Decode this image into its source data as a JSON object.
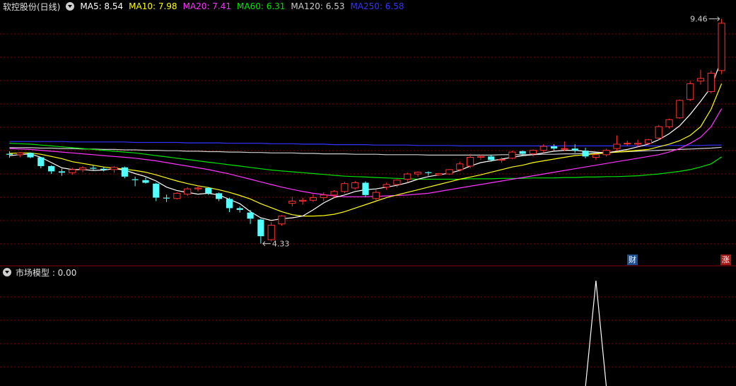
{
  "header": {
    "stock_title": "软控股份(日线)",
    "ma_labels": [
      {
        "text": "MA5: 8.54",
        "color": "#ffffff"
      },
      {
        "text": "MA10: 7.98",
        "color": "#ffff00"
      },
      {
        "text": "MA20: 7.41",
        "color": "#ff33ff"
      },
      {
        "text": "MA60: 6.31",
        "color": "#00e600"
      },
      {
        "text": "MA120: 6.53",
        "color": "#cccccc"
      },
      {
        "text": "MA250: 6.58",
        "color": "#3333ff"
      }
    ]
  },
  "sub_panel": {
    "label": "市场模型 : 0.00"
  },
  "badges": {
    "fin": "财",
    "limit_up": "涨"
  },
  "colors": {
    "up": "#ff3232",
    "down": "#54ffff",
    "grid": "#8b0000",
    "ma5": "#ffffff",
    "ma10": "#ffff00",
    "ma20": "#ff33ff",
    "ma60": "#00e600",
    "ma250": "#3333ff"
  },
  "chart_data": [
    {
      "type": "candlestick",
      "title": "软控股份(日线)",
      "ylim": [
        4.05,
        9.6
      ],
      "annotations": [
        {
          "text": "9.46",
          "value": 9.46,
          "candle_index": 68
        },
        {
          "text": "4.33",
          "value": 4.33,
          "candle_index": 24
        }
      ],
      "candles": [
        [
          6.38,
          6.44,
          6.29,
          6.36
        ],
        [
          6.36,
          6.42,
          6.3,
          6.4
        ],
        [
          6.4,
          6.41,
          6.28,
          6.3
        ],
        [
          6.3,
          6.31,
          6.05,
          6.1
        ],
        [
          6.1,
          6.12,
          5.92,
          5.98
        ],
        [
          5.98,
          6.04,
          5.88,
          5.95
        ],
        [
          5.95,
          6.06,
          5.9,
          6.02
        ],
        [
          6.02,
          6.1,
          5.96,
          6.06
        ],
        [
          6.06,
          6.12,
          6.0,
          6.04
        ],
        [
          6.04,
          6.08,
          5.98,
          6.02
        ],
        [
          6.02,
          6.1,
          5.95,
          6.07
        ],
        [
          6.07,
          6.09,
          5.82,
          5.86
        ],
        [
          5.8,
          5.86,
          5.64,
          5.78
        ],
        [
          5.78,
          5.84,
          5.7,
          5.72
        ],
        [
          5.7,
          5.72,
          5.3,
          5.38
        ],
        [
          5.38,
          5.45,
          5.28,
          5.36
        ],
        [
          5.36,
          5.5,
          5.34,
          5.48
        ],
        [
          5.46,
          5.62,
          5.42,
          5.58
        ],
        [
          5.58,
          5.66,
          5.52,
          5.6
        ],
        [
          5.6,
          5.62,
          5.44,
          5.48
        ],
        [
          5.48,
          5.5,
          5.3,
          5.35
        ],
        [
          5.35,
          5.38,
          5.05,
          5.14
        ],
        [
          5.14,
          5.18,
          5.04,
          5.1
        ],
        [
          5.04,
          5.1,
          4.78,
          4.9
        ],
        [
          4.88,
          4.9,
          4.33,
          4.5
        ],
        [
          4.42,
          4.82,
          4.38,
          4.75
        ],
        [
          4.78,
          4.98,
          4.74,
          4.96
        ],
        [
          5.25,
          5.4,
          5.18,
          5.3
        ],
        [
          5.3,
          5.38,
          5.22,
          5.32
        ],
        [
          5.32,
          5.46,
          5.28,
          5.38
        ],
        [
          5.38,
          5.5,
          5.3,
          5.44
        ],
        [
          5.44,
          5.55,
          5.38,
          5.52
        ],
        [
          5.52,
          5.74,
          5.48,
          5.7
        ],
        [
          5.6,
          5.76,
          5.56,
          5.72
        ],
        [
          5.72,
          5.75,
          5.4,
          5.44
        ],
        [
          5.36,
          5.56,
          5.32,
          5.5
        ],
        [
          5.62,
          5.72,
          5.56,
          5.68
        ],
        [
          5.68,
          5.8,
          5.62,
          5.78
        ],
        [
          5.8,
          5.95,
          5.74,
          5.92
        ],
        [
          5.92,
          5.98,
          5.86,
          5.96
        ],
        [
          5.96,
          5.98,
          5.88,
          5.94
        ],
        [
          5.9,
          5.94,
          5.88,
          5.93
        ],
        [
          5.92,
          6.03,
          5.9,
          6.02
        ],
        [
          6.02,
          6.2,
          5.98,
          6.15
        ],
        [
          6.1,
          6.38,
          6.05,
          6.3
        ],
        [
          6.3,
          6.36,
          6.24,
          6.32
        ],
        [
          6.32,
          6.36,
          6.2,
          6.24
        ],
        [
          6.24,
          6.3,
          6.18,
          6.25
        ],
        [
          6.28,
          6.45,
          6.26,
          6.42
        ],
        [
          6.44,
          6.46,
          6.34,
          6.38
        ],
        [
          6.38,
          6.48,
          6.32,
          6.46
        ],
        [
          6.46,
          6.6,
          6.4,
          6.55
        ],
        [
          6.55,
          6.6,
          6.44,
          6.5
        ],
        [
          6.5,
          6.66,
          6.44,
          6.5
        ],
        [
          6.5,
          6.6,
          6.4,
          6.45
        ],
        [
          6.45,
          6.52,
          6.28,
          6.32
        ],
        [
          6.3,
          6.38,
          6.24,
          6.36
        ],
        [
          6.36,
          6.5,
          6.32,
          6.46
        ],
        [
          6.5,
          6.8,
          6.44,
          6.6
        ],
        [
          6.62,
          6.68,
          6.56,
          6.62
        ],
        [
          6.6,
          6.7,
          6.52,
          6.62
        ],
        [
          6.62,
          6.72,
          6.58,
          6.7
        ],
        [
          6.74,
          7.04,
          6.7,
          7.0
        ],
        [
          7.0,
          7.18,
          6.96,
          7.16
        ],
        [
          7.2,
          7.62,
          7.18,
          7.6
        ],
        [
          7.62,
          8.04,
          7.58,
          7.98
        ],
        [
          8.04,
          8.3,
          7.96,
          8.1
        ],
        [
          7.8,
          8.28,
          7.76,
          8.22
        ],
        [
          8.28,
          9.46,
          8.2,
          9.36
        ]
      ],
      "ma5": [
        6.34,
        6.36,
        6.38,
        6.3,
        6.18,
        6.06,
        6.02,
        6.02,
        6.0,
        6.01,
        6.04,
        6.01,
        5.93,
        5.86,
        5.76,
        5.62,
        5.54,
        5.5,
        5.46,
        5.48,
        5.44,
        5.34,
        5.24,
        5.06,
        4.92,
        4.86,
        4.9,
        4.92,
        4.96,
        5.1,
        5.26,
        5.38,
        5.44,
        5.52,
        5.56,
        5.58,
        5.62,
        5.66,
        5.72,
        5.8,
        5.86,
        5.9,
        5.94,
        6.0,
        6.1,
        6.18,
        6.22,
        6.26,
        6.3,
        6.34,
        6.36,
        6.4,
        6.44,
        6.46,
        6.46,
        6.44,
        6.42,
        6.4,
        6.44,
        6.48,
        6.54,
        6.6,
        6.7,
        6.84,
        7.02,
        7.28,
        7.58,
        7.9,
        8.54
      ],
      "ma10": [
        6.39,
        6.4,
        6.4,
        6.37,
        6.32,
        6.27,
        6.2,
        6.16,
        6.12,
        6.08,
        6.05,
        6.03,
        6.0,
        5.96,
        5.9,
        5.83,
        5.76,
        5.7,
        5.65,
        5.61,
        5.56,
        5.5,
        5.43,
        5.35,
        5.24,
        5.15,
        5.06,
        4.99,
        4.96,
        4.96,
        4.97,
        5.0,
        5.06,
        5.14,
        5.22,
        5.3,
        5.38,
        5.44,
        5.5,
        5.56,
        5.62,
        5.68,
        5.74,
        5.8,
        5.85,
        5.9,
        5.96,
        6.02,
        6.08,
        6.12,
        6.18,
        6.22,
        6.26,
        6.3,
        6.34,
        6.36,
        6.38,
        6.4,
        6.42,
        6.44,
        6.46,
        6.48,
        6.54,
        6.6,
        6.68,
        6.8,
        7.0,
        7.4,
        7.98
      ],
      "ma20": [
        6.5,
        6.49,
        6.48,
        6.46,
        6.44,
        6.42,
        6.4,
        6.38,
        6.36,
        6.34,
        6.32,
        6.3,
        6.28,
        6.25,
        6.22,
        6.18,
        6.14,
        6.1,
        6.06,
        6.02,
        5.97,
        5.92,
        5.86,
        5.8,
        5.74,
        5.68,
        5.62,
        5.57,
        5.52,
        5.48,
        5.45,
        5.42,
        5.4,
        5.4,
        5.4,
        5.41,
        5.42,
        5.43,
        5.44,
        5.46,
        5.48,
        5.52,
        5.56,
        5.6,
        5.64,
        5.68,
        5.72,
        5.76,
        5.8,
        5.84,
        5.88,
        5.92,
        5.96,
        6.0,
        6.04,
        6.08,
        6.12,
        6.16,
        6.2,
        6.24,
        6.28,
        6.32,
        6.36,
        6.42,
        6.5,
        6.62,
        6.76,
        7.0,
        7.41
      ],
      "ma60": [
        6.62,
        6.61,
        6.6,
        6.58,
        6.56,
        6.54,
        6.52,
        6.5,
        6.48,
        6.46,
        6.44,
        6.42,
        6.4,
        6.37,
        6.34,
        6.31,
        6.28,
        6.25,
        6.22,
        6.19,
        6.16,
        6.13,
        6.1,
        6.07,
        6.04,
        6.01,
        5.99,
        5.97,
        5.95,
        5.93,
        5.91,
        5.89,
        5.87,
        5.86,
        5.85,
        5.84,
        5.83,
        5.82,
        5.81,
        5.8,
        5.8,
        5.8,
        5.8,
        5.8,
        5.81,
        5.81,
        5.81,
        5.82,
        5.82,
        5.82,
        5.83,
        5.83,
        5.83,
        5.84,
        5.84,
        5.85,
        5.85,
        5.86,
        5.86,
        5.87,
        5.88,
        5.9,
        5.92,
        5.95,
        5.98,
        6.02,
        6.08,
        6.15,
        6.31
      ],
      "ma120": [
        6.52,
        6.52,
        6.52,
        6.51,
        6.51,
        6.5,
        6.5,
        6.49,
        6.49,
        6.48,
        6.48,
        6.47,
        6.47,
        6.46,
        6.46,
        6.45,
        6.45,
        6.44,
        6.44,
        6.43,
        6.43,
        6.42,
        6.42,
        6.41,
        6.41,
        6.4,
        6.4,
        6.4,
        6.39,
        6.39,
        6.38,
        6.38,
        6.38,
        6.37,
        6.37,
        6.37,
        6.36,
        6.36,
        6.36,
        6.36,
        6.35,
        6.35,
        6.35,
        6.35,
        6.35,
        6.35,
        6.35,
        6.36,
        6.36,
        6.36,
        6.36,
        6.37,
        6.37,
        6.38,
        6.38,
        6.39,
        6.4,
        6.41,
        6.42,
        6.43,
        6.44,
        6.45,
        6.46,
        6.47,
        6.48,
        6.49,
        6.5,
        6.51,
        6.53
      ],
      "ma250": [
        6.66,
        6.66,
        6.66,
        6.66,
        6.66,
        6.66,
        6.65,
        6.65,
        6.65,
        6.65,
        6.65,
        6.65,
        6.64,
        6.64,
        6.64,
        6.64,
        6.64,
        6.63,
        6.63,
        6.63,
        6.63,
        6.62,
        6.62,
        6.62,
        6.62,
        6.61,
        6.61,
        6.61,
        6.6,
        6.6,
        6.6,
        6.59,
        6.59,
        6.59,
        6.59,
        6.58,
        6.58,
        6.58,
        6.58,
        6.57,
        6.57,
        6.57,
        6.57,
        6.56,
        6.56,
        6.56,
        6.56,
        6.56,
        6.56,
        6.56,
        6.56,
        6.56,
        6.56,
        6.56,
        6.56,
        6.56,
        6.56,
        6.56,
        6.56,
        6.56,
        6.56,
        6.56,
        6.56,
        6.57,
        6.57,
        6.57,
        6.57,
        6.58,
        6.58
      ]
    },
    {
      "type": "line",
      "title": "市场模型",
      "current_value": 0.0,
      "ylim": [
        0,
        1
      ],
      "values": [
        0,
        0,
        0,
        0,
        0,
        0,
        0,
        0,
        0,
        0,
        0,
        0,
        0,
        0,
        0,
        0,
        0,
        0,
        0,
        0,
        0,
        0,
        0,
        0,
        0,
        0,
        0,
        0,
        0,
        0,
        0,
        0,
        0,
        0,
        0,
        0,
        0,
        0,
        0,
        0,
        0,
        0,
        0,
        0,
        0,
        0,
        0,
        0,
        0,
        0,
        0,
        0,
        0,
        0,
        0,
        0,
        1,
        0,
        0,
        0,
        0,
        0,
        0,
        0,
        0,
        0,
        0,
        0,
        0
      ]
    }
  ]
}
